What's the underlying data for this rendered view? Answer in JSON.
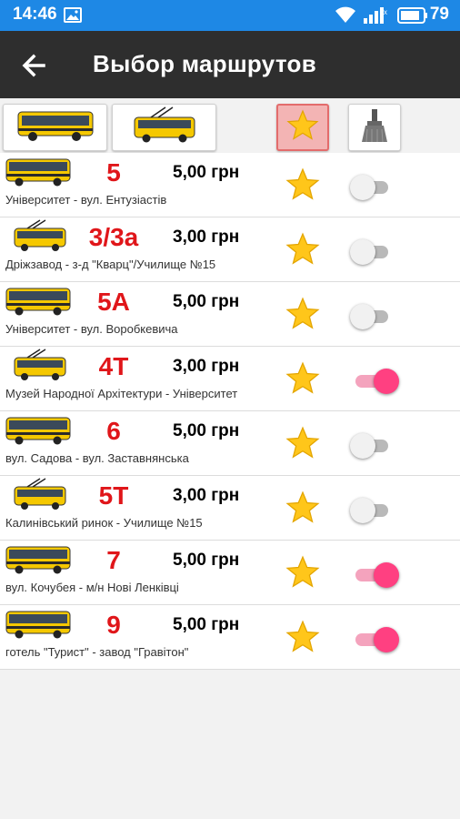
{
  "status_bar": {
    "time": "14:46",
    "battery": "79"
  },
  "toolbar": {
    "title": "Выбор маршрутов"
  },
  "colors": {
    "status_bar": "#1e88e5",
    "toolbar": "#2e2e2e",
    "route_number": "#e0161a",
    "toggle_on": "#ff4081",
    "bus_body": "#f5c800"
  },
  "filters": [
    {
      "name": "bus-filter",
      "icon": "bus-icon"
    },
    {
      "name": "trolleybus-filter",
      "icon": "trolleybus-icon"
    },
    {
      "name": "favorites-filter",
      "icon": "star-icon",
      "selected": true
    },
    {
      "name": "clear-filter",
      "icon": "brush-icon"
    }
  ],
  "routes": [
    {
      "number": "5",
      "price": "5,00  грн",
      "description": "Університет - вул. Ентузіастів",
      "vehicle": "bus",
      "favorite": true,
      "enabled": false
    },
    {
      "number": "3/3а",
      "price": "3,00  грн",
      "description": "Дріжзавод - з-д \"Кварц\"/Училище №15",
      "vehicle": "trolleybus",
      "favorite": true,
      "enabled": false
    },
    {
      "number": "5А",
      "price": "5,00  грн",
      "description": "Університет - вул. Воробкевича",
      "vehicle": "bus",
      "favorite": true,
      "enabled": false
    },
    {
      "number": "4Т",
      "price": "3,00  грн",
      "description": "Музей Народної Архітектури - Університет",
      "vehicle": "trolleybus",
      "favorite": true,
      "enabled": true
    },
    {
      "number": "6",
      "price": "5,00  грн",
      "description": "вул. Садова - вул. Заставнянська",
      "vehicle": "bus",
      "favorite": true,
      "enabled": false
    },
    {
      "number": "5Т",
      "price": "3,00  грн",
      "description": "Калинівський ринок - Училище №15",
      "vehicle": "trolleybus",
      "favorite": true,
      "enabled": false
    },
    {
      "number": "7",
      "price": "5,00  грн",
      "description": "вул. Кочубея - м/н Нові Ленківці",
      "vehicle": "bus",
      "favorite": true,
      "enabled": true
    },
    {
      "number": "9",
      "price": "5,00  грн",
      "description": "готель \"Турист\" - завод \"Гравітон\"",
      "vehicle": "bus",
      "favorite": true,
      "enabled": true
    }
  ]
}
